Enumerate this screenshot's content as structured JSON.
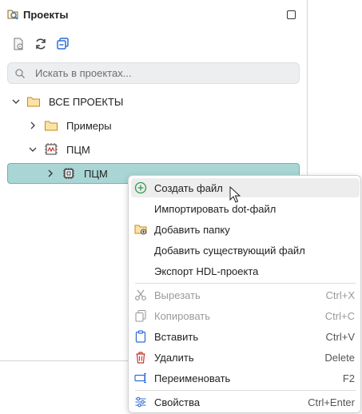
{
  "panel": {
    "title": "Проекты",
    "search_placeholder": "Искать в проектах..."
  },
  "tree": {
    "items": [
      {
        "label": "ВСЕ ПРОЕКТЫ"
      },
      {
        "label": "Примеры"
      },
      {
        "label": "ПЦМ"
      },
      {
        "label": "ПЦМ"
      }
    ]
  },
  "context_menu": {
    "items": [
      {
        "label": "Создать файл",
        "shortcut": ""
      },
      {
        "label": "Импортировать dot-файл",
        "shortcut": ""
      },
      {
        "label": "Добавить папку",
        "shortcut": ""
      },
      {
        "label": "Добавить существующий файл",
        "shortcut": ""
      },
      {
        "label": "Экспорт HDL-проекта",
        "shortcut": ""
      },
      {
        "label": "Вырезать",
        "shortcut": "Ctrl+X"
      },
      {
        "label": "Копировать",
        "shortcut": "Ctrl+C"
      },
      {
        "label": "Вставить",
        "shortcut": "Ctrl+V"
      },
      {
        "label": "Удалить",
        "shortcut": "Delete"
      },
      {
        "label": "Переименовать",
        "shortcut": "F2"
      },
      {
        "label": "Свойства",
        "shortcut": "Ctrl+Enter"
      }
    ]
  },
  "colors": {
    "selection": "#a9d6d4",
    "selection_border": "#6fb3b0",
    "folder": "#e9b64a",
    "accent_blue": "#2f6fd6",
    "delete_red": "#c8342e",
    "create_green": "#2e9b4a"
  }
}
